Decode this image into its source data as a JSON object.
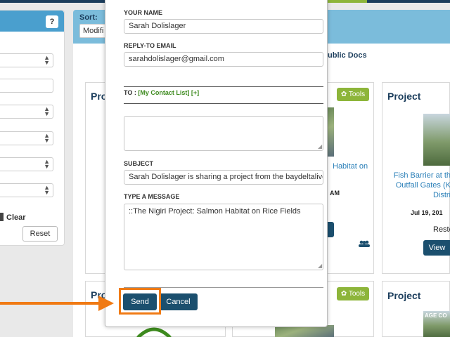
{
  "filters": {
    "help_label": "?",
    "clear_label": "Clear",
    "reset_label": "Reset"
  },
  "sort": {
    "label": "Sort:",
    "value": "Modifi"
  },
  "tabs": {
    "public_docs": "ublic Docs"
  },
  "cards": [
    {
      "title": "Pro"
    },
    {
      "title": "",
      "tools_label": "Tools",
      "project_text": "Habitat on",
      "date_fragment": "AM"
    },
    {
      "title": "Project",
      "project_text": "Fish Barrier at th Outfall Gates (K Distri",
      "date": "Jul 19, 201",
      "status": "Resto",
      "view_label": "View"
    },
    {
      "title": "Pro"
    },
    {
      "title": "",
      "tools_label": "Tools"
    },
    {
      "title": "Project",
      "caption": "AGE CO"
    }
  ],
  "modal": {
    "your_name_label": "YOUR NAME",
    "your_name_value": "Sarah Dolislager",
    "reply_label": "REPLY-TO EMAIL",
    "reply_value": "sarahdolislager@gmail.com",
    "to_prefix": "TO : ",
    "to_link": "[My Contact List]",
    "to_add": " [+]",
    "recipients_value": "",
    "subject_label": "SUBJECT",
    "subject_value": "Sarah Dolislager is sharing a project from the baydeltalive.",
    "message_label": "TYPE A MESSAGE",
    "message_value": "::The Nigiri Project: Salmon Habitat on Rice Fields",
    "send_label": "Send",
    "cancel_label": "Cancel"
  },
  "colors": {
    "highlight": "#f07a14",
    "primary_button": "#1b4f6e",
    "tools_button": "#8db53a",
    "header_blue": "#4a9fce"
  }
}
